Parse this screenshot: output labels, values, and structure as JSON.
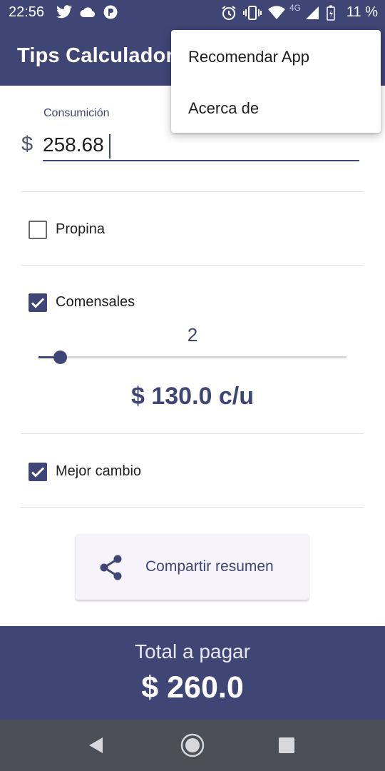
{
  "status_bar": {
    "time": "22:56",
    "battery_text": "11 %",
    "network": "4G",
    "icons": [
      "twitter-icon",
      "cloud-icon",
      "p-app-icon",
      "alarm-icon",
      "vibrate-icon",
      "wifi-icon",
      "signal-icon",
      "battery-icon"
    ]
  },
  "app_bar": {
    "title": "Tips Calculadora"
  },
  "overflow_menu": {
    "items": [
      "Recomendar App",
      "Acerca de"
    ]
  },
  "consumption": {
    "label": "Consumición",
    "currency": "$",
    "value": "258.68"
  },
  "options": {
    "tip": {
      "label": "Propina",
      "checked": false
    },
    "diners": {
      "label": "Comensales",
      "checked": true,
      "count": "2",
      "per_person": "$ 130.0 c/u"
    },
    "best_change": {
      "label": "Mejor cambio",
      "checked": true
    }
  },
  "share_button": {
    "label": "Compartir resumen",
    "icon": "share-icon"
  },
  "total": {
    "label": "Total a pagar",
    "value": "$ 260.0"
  },
  "nav_bar": {
    "icons": [
      "back-icon",
      "home-icon",
      "recents-icon"
    ]
  },
  "colors": {
    "primary": "#3f4574",
    "surface": "#ffffff",
    "button_bg": "#f6f3fb",
    "nav_bar": "#4a4f58"
  }
}
